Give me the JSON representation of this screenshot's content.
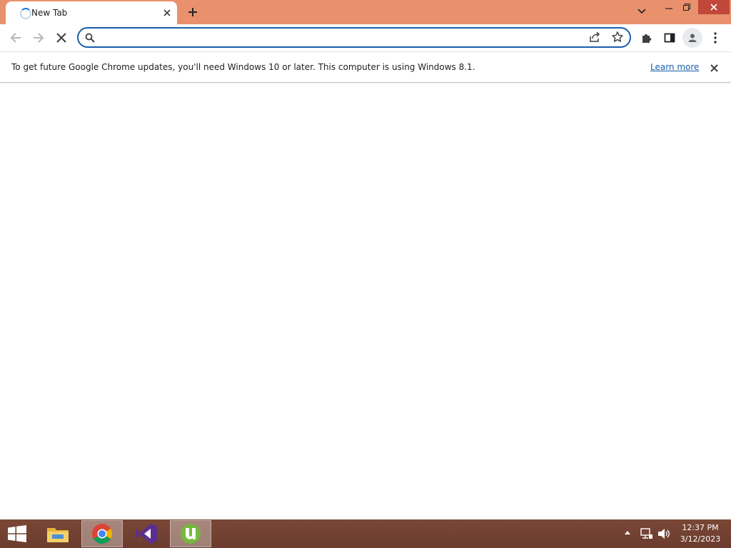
{
  "browser": {
    "tab": {
      "title": "New Tab"
    },
    "omnibox": {
      "value": "",
      "placeholder": ""
    },
    "infobar": {
      "message": "To get future Google Chrome updates, you'll need Windows 10 or later. This computer is using Windows 8.1.",
      "link_label": "Learn more"
    },
    "colors": {
      "frame": "#e8916c",
      "accent": "#1a5ea8",
      "link": "#1a5ea8"
    }
  },
  "taskbar": {
    "apps": [
      {
        "name": "file-explorer",
        "active": false
      },
      {
        "name": "chrome",
        "active": true
      },
      {
        "name": "visual-studio",
        "active": false
      },
      {
        "name": "utorrent",
        "active": true
      }
    ],
    "clock": {
      "time": "12:37 PM",
      "date": "3/12/2023"
    },
    "color": "#6e3e30"
  }
}
